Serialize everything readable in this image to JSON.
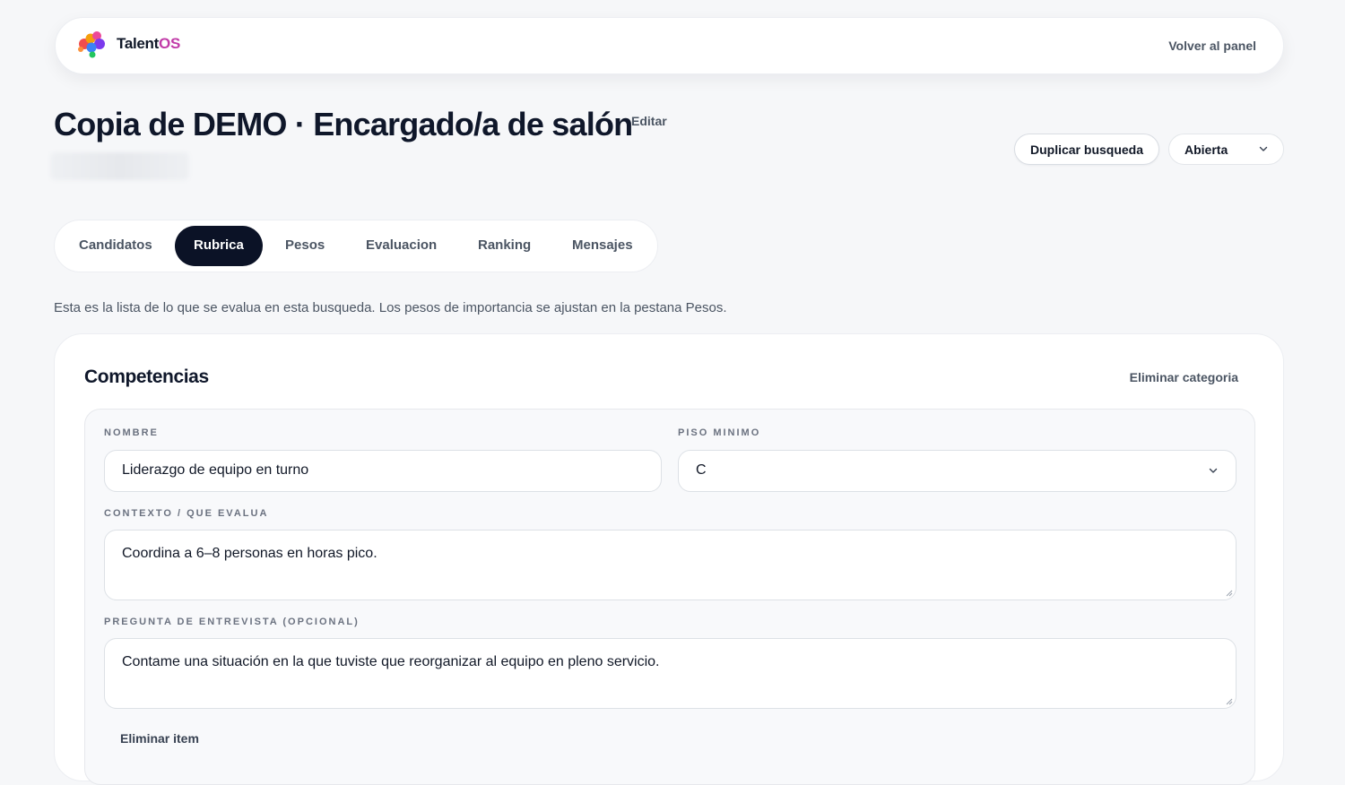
{
  "header": {
    "brand_name": "Talent",
    "brand_suffix": "OS",
    "back_link": "Volver al panel"
  },
  "search": {
    "title": "Copia de DEMO · Encargado/a de salón",
    "edit_label": "Editar",
    "duplicate_label": "Duplicar busqueda",
    "status_value": "Abierta"
  },
  "tabs": [
    {
      "label": "Candidatos",
      "active": false
    },
    {
      "label": "Rubrica",
      "active": true
    },
    {
      "label": "Pesos",
      "active": false
    },
    {
      "label": "Evaluacion",
      "active": false
    },
    {
      "label": "Ranking",
      "active": false
    },
    {
      "label": "Mensajes",
      "active": false
    }
  ],
  "intro_text": "Esta es la lista de lo que se evalua en esta busqueda. Los pesos de importancia se ajustan en la pestana Pesos.",
  "category": {
    "title": "Competencias",
    "delete_label": "Eliminar categoria",
    "item": {
      "name_label": "NOMBRE",
      "name_value": "Liderazgo de equipo en turno",
      "floor_label": "PISO MINIMO",
      "floor_value": "C",
      "context_label": "CONTEXTO / QUE EVALUA",
      "context_value": "Coordina a 6–8 personas en horas pico.",
      "question_label": "PREGUNTA DE ENTREVISTA (OPCIONAL)",
      "question_value": "Contame una situación en la que tuviste que reorganizar al equipo en pleno servicio.",
      "delete_label": "Eliminar item"
    }
  },
  "colors": {
    "background": "#f6f7f9",
    "active_tab": "#0b1226",
    "brand_accent": "#c13ba8"
  }
}
